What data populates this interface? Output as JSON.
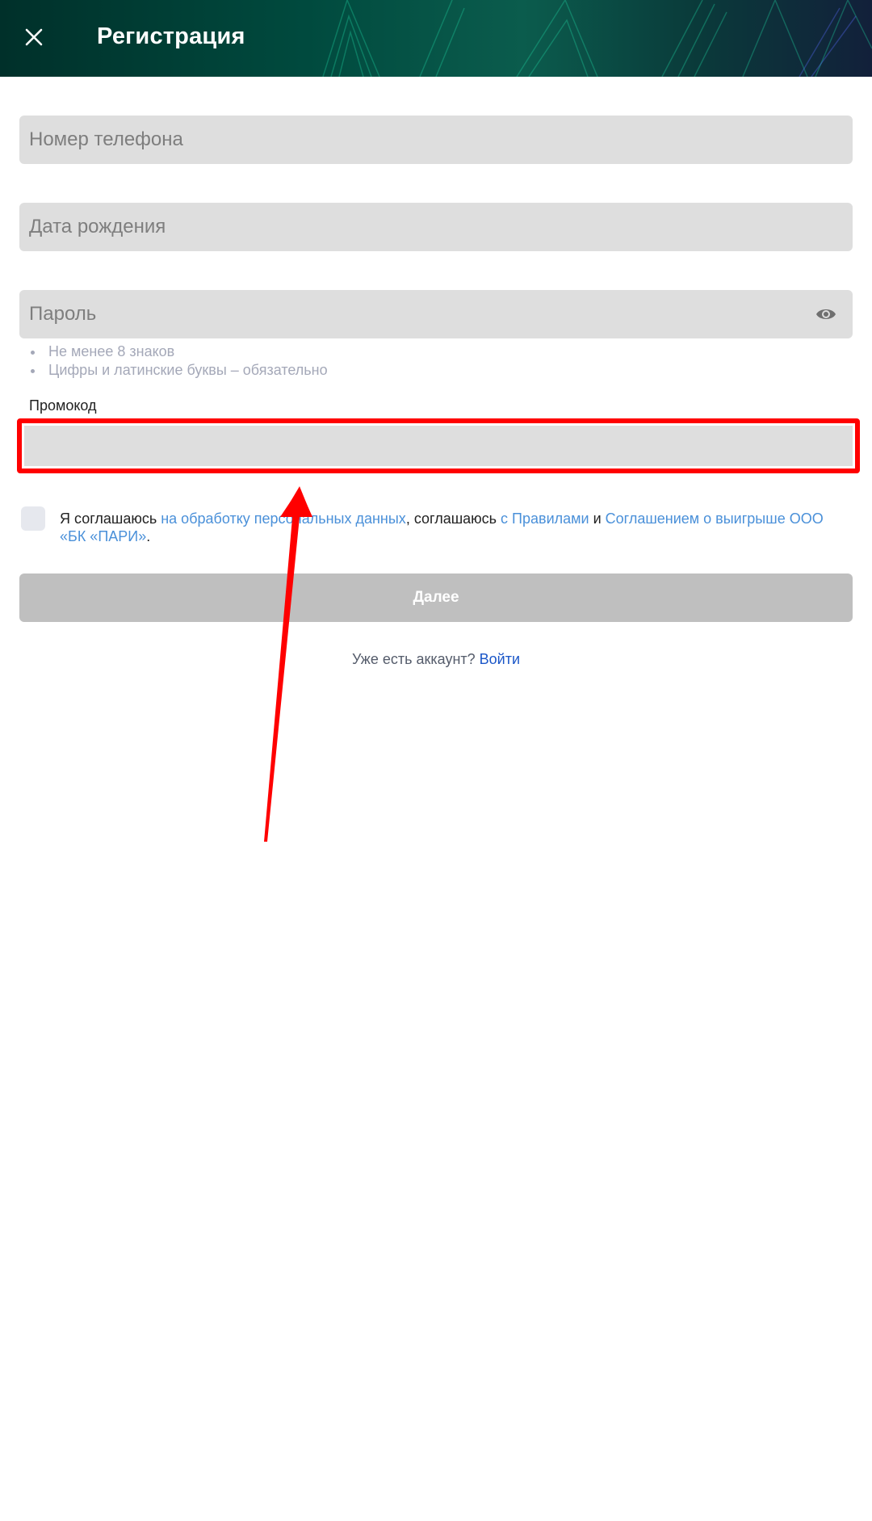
{
  "header": {
    "title": "Регистрация",
    "close_icon": "close-icon"
  },
  "form": {
    "phone_placeholder": "Номер телефона",
    "birthdate_placeholder": "Дата рождения",
    "password_placeholder": "Пароль",
    "password_toggle_icon": "eye-icon",
    "password_hints": [
      "Не менее 8 знаков",
      "Цифры и латинские буквы – обязательно"
    ],
    "promo_label": "Промокод",
    "promo_value": ""
  },
  "agreement": {
    "text_1": "Я соглашаюсь ",
    "link_1": "на обработку персональных данных",
    "text_2": ", соглашаюсь ",
    "link_2": "с Правилами",
    "text_3": " и ",
    "link_3": "Соглашением о выигрыше ООО «БК «ПАРИ»",
    "text_4": "."
  },
  "actions": {
    "next_label": "Далее",
    "login_prompt": "Уже есть аккаунт? ",
    "login_link": "Войти"
  },
  "colors": {
    "highlight": "#ff0000",
    "link": "#4a90d9",
    "login_link": "#1a56c8",
    "button_disabled": "#bfbfbf"
  }
}
